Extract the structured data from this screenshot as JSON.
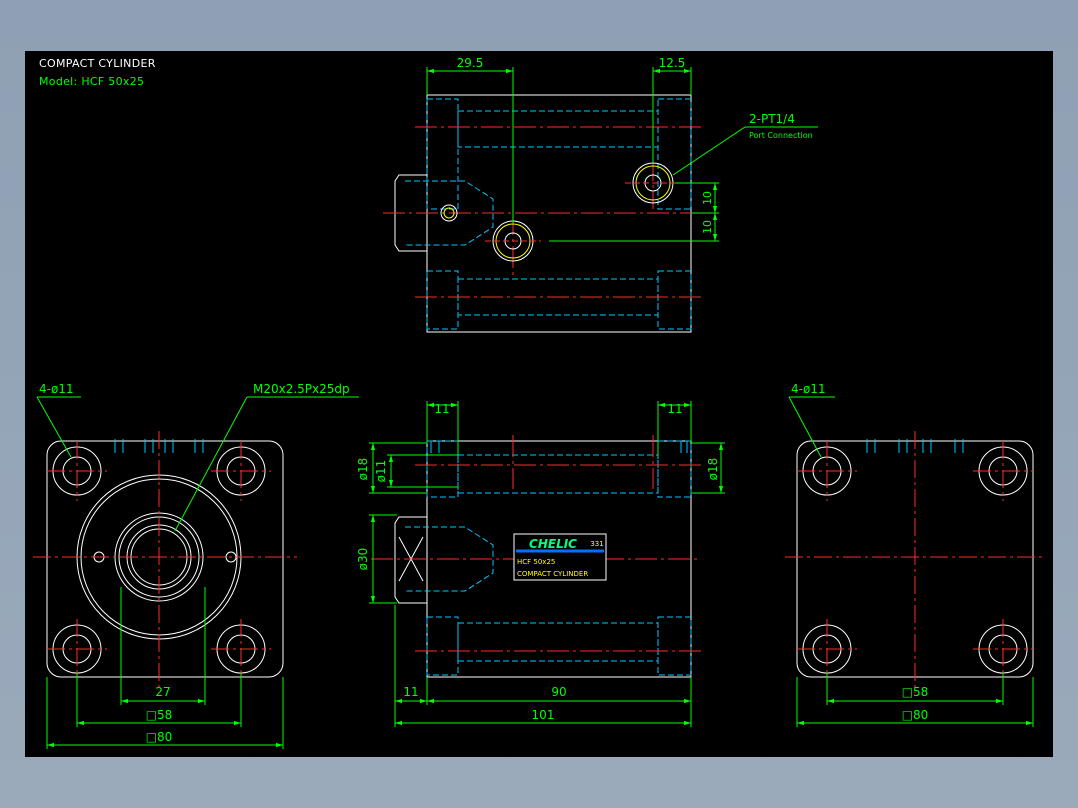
{
  "title": {
    "name": "COMPACT CYLINDER",
    "model": "Model:  HCF 50x25"
  },
  "colors": {
    "background": "#000000",
    "outline": "#ffffff",
    "hidden": "#00c8ff",
    "centerline": "#ff2a2a",
    "dimension": "#00ff00",
    "text": "#ffffff",
    "accent": "#ffff00"
  },
  "top_view": {
    "dim_left": "29.5",
    "dim_right": "12.5",
    "port_callout": "2-PT1/4",
    "port_sub": "Port Connection",
    "dim_v1": "10",
    "dim_v2": "10"
  },
  "left_view": {
    "hole_callout": "4-ø11",
    "thread_callout": "M20x2.5Px25dp",
    "dim_bore": "27",
    "dim_pitch": "□58",
    "dim_outer": "□80"
  },
  "front_view": {
    "dim_top_left": "11",
    "dim_top_right": "11",
    "dim_d18_left": "ø18",
    "dim_d11": "ø11",
    "dim_d18_right": "ø18",
    "dim_d30": "ø30",
    "dim_b11": "11",
    "dim_b90": "90",
    "dim_b101": "101",
    "label_brand": "CHELIC",
    "label_code": "331",
    "label_model": "HCF 50x25",
    "label_name": "COMPACT CYLINDER"
  },
  "right_view": {
    "hole_callout": "4-ø11",
    "dim_pitch": "□58",
    "dim_outer": "□80"
  }
}
